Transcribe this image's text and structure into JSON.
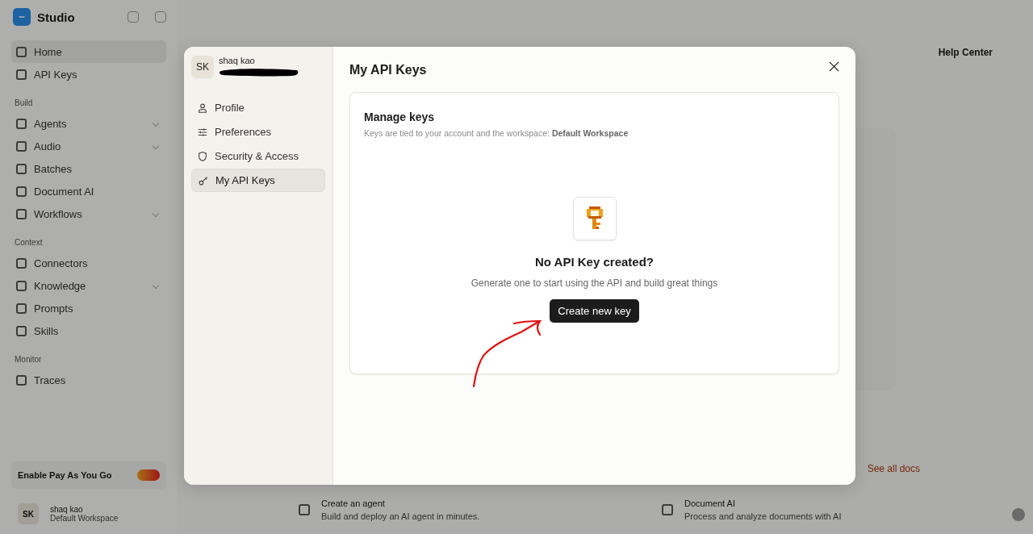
{
  "app": {
    "brand": "Studio",
    "nav": [
      {
        "kind": "link",
        "label": "Home",
        "selected": true
      },
      {
        "kind": "link",
        "label": "API Keys",
        "selected": false
      },
      {
        "kind": "section",
        "label": "Build"
      },
      {
        "kind": "group",
        "label": "Agents",
        "selected": false
      },
      {
        "kind": "group",
        "label": "Audio",
        "selected": false
      },
      {
        "kind": "link",
        "label": "Batches",
        "selected": false
      },
      {
        "kind": "link",
        "label": "Document AI",
        "selected": false
      },
      {
        "kind": "group",
        "label": "Workflows",
        "selected": false
      },
      {
        "kind": "section",
        "label": "Context"
      },
      {
        "kind": "link",
        "label": "Connectors",
        "selected": false
      },
      {
        "kind": "group",
        "label": "Knowledge",
        "selected": false
      },
      {
        "kind": "link",
        "label": "Prompts",
        "selected": false
      },
      {
        "kind": "link",
        "label": "Skills",
        "selected": false
      },
      {
        "kind": "section",
        "label": "Monitor"
      },
      {
        "kind": "link",
        "label": "Traces",
        "selected": false
      }
    ],
    "promo": {
      "label": "Enable Pay As You Go"
    },
    "user": {
      "initials": "SK",
      "name": "shaq kao",
      "workspace": "Default Workspace"
    },
    "help_link": "Help Center",
    "docs_link": "See all docs",
    "quick_links": [
      {
        "title": "Create an agent",
        "text": "Build and deploy an AI agent in minutes."
      },
      {
        "title": "Document AI",
        "text": "Process and analyze documents with AI"
      }
    ]
  },
  "dialog": {
    "user": {
      "initials": "SK",
      "name": "shaq kao",
      "email_redacted": true
    },
    "menu": [
      {
        "label": "Profile",
        "selected": false
      },
      {
        "label": "Preferences",
        "selected": false
      },
      {
        "label": "Security & Access",
        "selected": false
      },
      {
        "label": "My API Keys",
        "selected": true
      }
    ],
    "title": "My API Keys",
    "card": {
      "title": "Manage keys",
      "subtitle": "Keys are tied to your account and the workspace: **Default Workspace**",
      "empty_title": "No API Key created?",
      "empty_text": "Generate one to start using the API and build great things",
      "button": "Create new key"
    },
    "annotation_arrow": true
  }
}
